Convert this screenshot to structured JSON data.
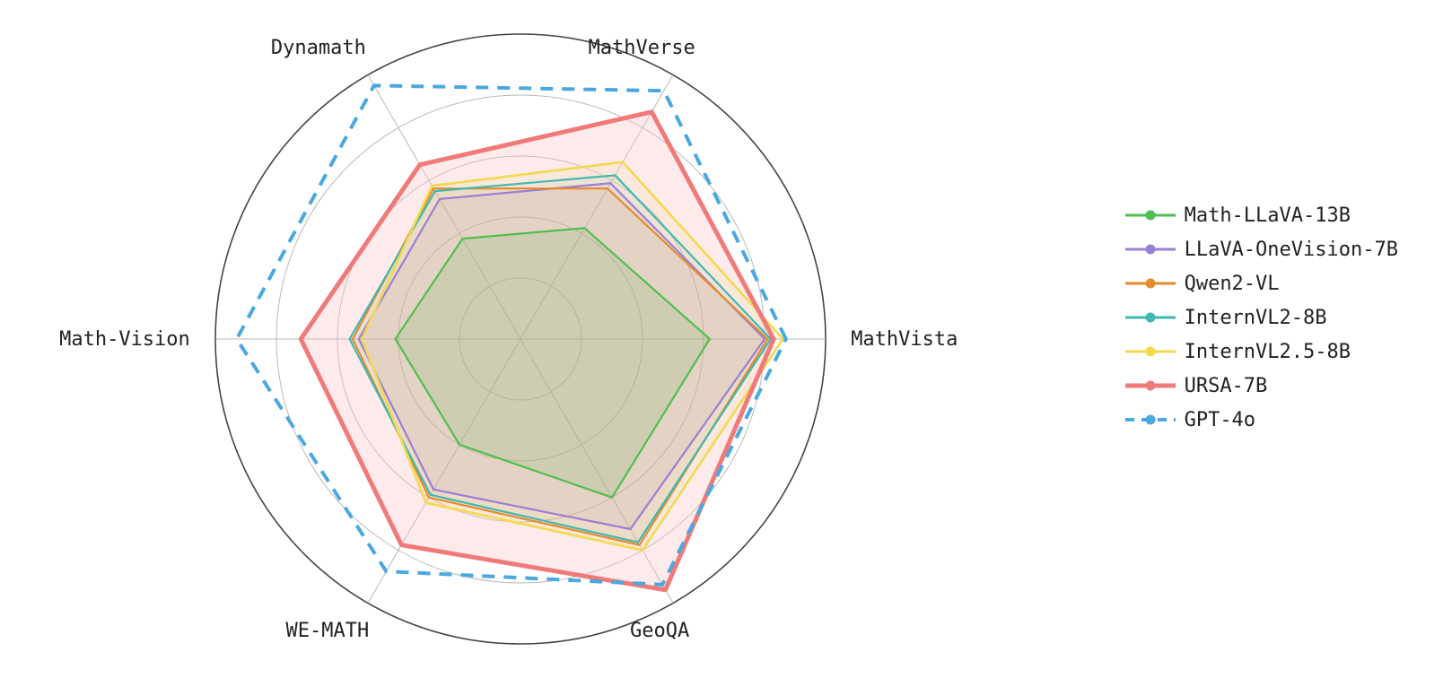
{
  "chart_data": {
    "type": "radar",
    "categories": [
      "MathVista",
      "MathVerse",
      "Dynamath",
      "Math-Vision",
      "WE-MATH",
      "GeoQA"
    ],
    "grid_levels": [
      0.2,
      0.4,
      0.6,
      0.8,
      1.0
    ],
    "series": [
      {
        "name": "Math-LLaVA-13B",
        "color": "#4fbf4f",
        "fill": "#4fbf4f",
        "fill_opacity": 0.18,
        "style": "solid",
        "width": 2.2,
        "marker": true,
        "values": [
          0.62,
          0.42,
          0.38,
          0.41,
          0.4,
          0.6
        ]
      },
      {
        "name": "LLaVA-OneVision-7B",
        "color": "#9a7fd6",
        "fill": "#9a7fd6",
        "fill_opacity": 0.1,
        "style": "solid",
        "width": 2.2,
        "marker": true,
        "values": [
          0.8,
          0.59,
          0.53,
          0.53,
          0.57,
          0.72
        ]
      },
      {
        "name": "Qwen2-VL",
        "color": "#e68a2e",
        "fill": "#e68a2e",
        "fill_opacity": 0.1,
        "style": "solid",
        "width": 2.2,
        "marker": true,
        "values": [
          0.81,
          0.57,
          0.57,
          0.55,
          0.6,
          0.78
        ]
      },
      {
        "name": "InternVL2-8B",
        "color": "#3fb8b0",
        "fill": "#3fb8b0",
        "fill_opacity": 0.08,
        "style": "solid",
        "width": 2.2,
        "marker": true,
        "values": [
          0.82,
          0.62,
          0.56,
          0.56,
          0.59,
          0.77
        ]
      },
      {
        "name": "InternVL2.5-8B",
        "color": "#f2d94e",
        "fill": "#f2d94e",
        "fill_opacity": 0.1,
        "style": "solid",
        "width": 2.6,
        "marker": true,
        "values": [
          0.86,
          0.67,
          0.58,
          0.52,
          0.62,
          0.8
        ]
      },
      {
        "name": "URSA-7B",
        "color": "#f07a7a",
        "fill": "#f9c4c4",
        "fill_opacity": 0.35,
        "style": "solid",
        "width": 5,
        "marker": false,
        "values": [
          0.83,
          0.86,
          0.66,
          0.72,
          0.78,
          0.95
        ]
      },
      {
        "name": "GPT-4o",
        "color": "#4aa8e0",
        "fill": null,
        "fill_opacity": 0,
        "style": "dashed",
        "width": 4,
        "marker": true,
        "values": [
          0.87,
          0.94,
          0.96,
          0.93,
          0.88,
          0.93
        ]
      }
    ]
  },
  "legend": {
    "items": [
      {
        "label": "Math-LLaVA-13B"
      },
      {
        "label": "LLaVA-OneVision-7B"
      },
      {
        "label": "Qwen2-VL"
      },
      {
        "label": "InternVL2-8B"
      },
      {
        "label": "InternVL2.5-8B"
      },
      {
        "label": "URSA-7B"
      },
      {
        "label": "GPT-4o"
      }
    ]
  },
  "axis_labels": {
    "0": "MathVista",
    "1": "MathVerse",
    "2": "Dynamath",
    "3": "Math-Vision",
    "4": "WE-MATH",
    "5": "GeoQA"
  }
}
